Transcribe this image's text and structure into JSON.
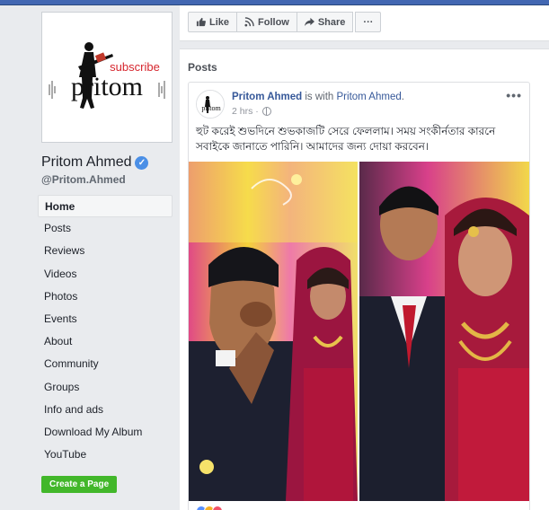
{
  "page": {
    "name": "Pritom Ahmed",
    "handle": "@Pritom.Ahmed",
    "logo_text": "pritom",
    "logo_subscribe": "subscribe"
  },
  "nav": {
    "items": [
      {
        "label": "Home",
        "active": true
      },
      {
        "label": "Posts"
      },
      {
        "label": "Reviews"
      },
      {
        "label": "Videos"
      },
      {
        "label": "Photos"
      },
      {
        "label": "Events"
      },
      {
        "label": "About"
      },
      {
        "label": "Community"
      },
      {
        "label": "Groups"
      },
      {
        "label": "Info and ads"
      },
      {
        "label": "Download My Album"
      },
      {
        "label": "YouTube"
      }
    ],
    "create_page": "Create a Page"
  },
  "actions": {
    "like": "Like",
    "follow": "Follow",
    "share": "Share",
    "more": "···"
  },
  "posts": {
    "title": "Posts",
    "post": {
      "author": "Pritom Ahmed",
      "with_text": " is with ",
      "tagged": "Pritom Ahmed",
      "tagged_suffix": ".",
      "time": "2 hrs ·",
      "menu": "•••",
      "text": "হুট করেই শুভদিনে শুভকাজটি সেরে ফেললাম। সময় সংকীর্নতার কারনে সবাইকে জানাতে পারিনি। আমাদের জন্য দোয়া করবেন।"
    }
  },
  "colors": {
    "brand": "#4267b2",
    "link": "#365899",
    "create_page": "#42b72a",
    "verified": "#4b8fe6"
  }
}
